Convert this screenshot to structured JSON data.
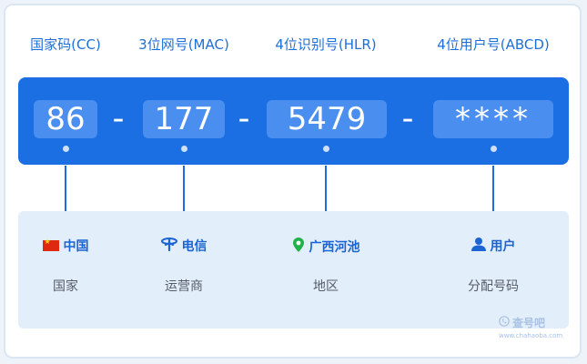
{
  "segments": [
    {
      "header": "国家码(CC)",
      "value": "86",
      "label": "中国",
      "icon": "china-flag-icon",
      "description": "国家"
    },
    {
      "header": "3位网号(MAC)",
      "value": "177",
      "label": "电信",
      "icon": "telecom-icon",
      "description": "运营商"
    },
    {
      "header": "4位识别号(HLR)",
      "value": "5479",
      "label": "广西河池",
      "icon": "location-pin-icon",
      "description": "地区"
    },
    {
      "header": "4位用户号(ABCD)",
      "value": "****",
      "label": "用户",
      "icon": "user-icon",
      "description": "分配号码"
    }
  ],
  "separator": "-",
  "watermark": {
    "title": "查号吧",
    "url": "www.chahaoba.com"
  },
  "colors": {
    "primary": "#1b6fe3",
    "box": "#4a8ef0",
    "panel": "#e3eefb",
    "header_text": "#1f6fd8"
  }
}
